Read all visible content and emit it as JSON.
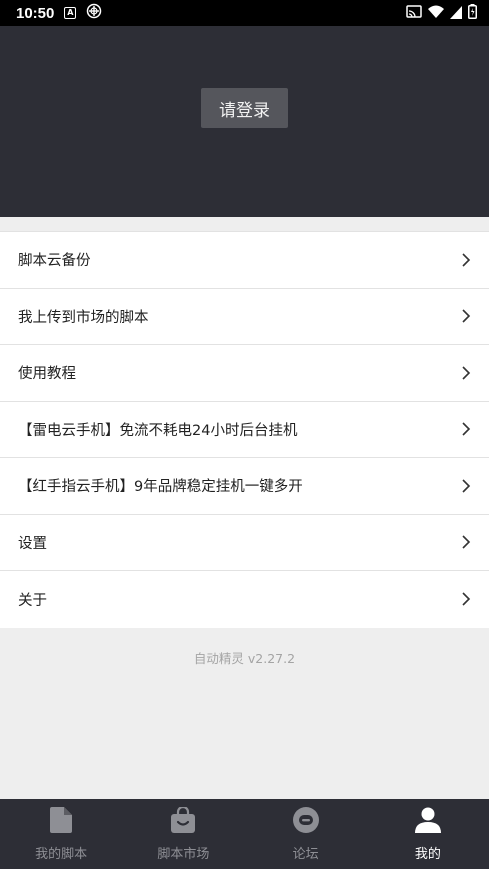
{
  "status_bar": {
    "time": "10:50",
    "icons": [
      "a-badge-icon",
      "android-icon",
      "cast-icon",
      "wifi-icon",
      "signal-icon",
      "battery-icon"
    ]
  },
  "header": {
    "login_label": "请登录"
  },
  "menu": {
    "items": [
      {
        "label": "脚本云备份"
      },
      {
        "label": "我上传到市场的脚本"
      },
      {
        "label": "使用教程"
      },
      {
        "label": "【雷电云手机】免流不耗电24小时后台挂机"
      },
      {
        "label": "【红手指云手机】9年品牌稳定挂机一键多开"
      },
      {
        "label": "设置"
      },
      {
        "label": "关于"
      }
    ]
  },
  "version_text": "自动精灵 v2.27.2",
  "bottom_nav": {
    "items": [
      {
        "label": "我的脚本",
        "icon": "file-icon",
        "active": false
      },
      {
        "label": "脚本市场",
        "icon": "shopping-bag-icon",
        "active": false
      },
      {
        "label": "论坛",
        "icon": "chat-icon",
        "active": false
      },
      {
        "label": "我的",
        "icon": "person-icon",
        "active": true
      }
    ]
  },
  "colors": {
    "header_bg": "#2d2e36",
    "page_bg": "#eeeeee",
    "nav_inactive": "#8e8f95",
    "nav_active": "#ffffff"
  }
}
